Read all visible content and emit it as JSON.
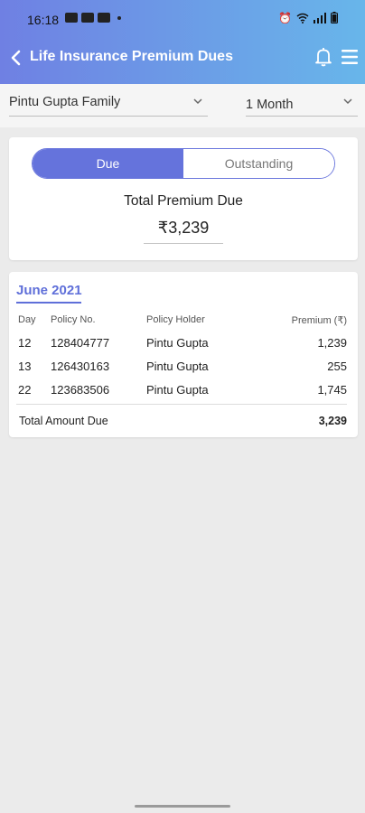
{
  "status_bar": {
    "time": "16:18",
    "left_icons": [
      "image-icon",
      "notification-icon",
      "notification-icon"
    ],
    "right_icons": [
      "alarm-icon",
      "wifi-icon",
      "signal-icon",
      "battery-icon"
    ]
  },
  "header": {
    "title": "Life Insurance Premium Dues",
    "back_icon": "chevron-left-icon",
    "bell_icon": "bell-icon",
    "menu_icon": "hamburger-menu-icon"
  },
  "filters": {
    "family": "Pintu Gupta Family",
    "period": "1 Month"
  },
  "summary": {
    "tabs": [
      "Due",
      "Outstanding"
    ],
    "active_tab": "Due",
    "title": "Total Premium Due",
    "amount": "₹3,239"
  },
  "table": {
    "month": "June 2021",
    "headers": {
      "day": "Day",
      "policy": "Policy No.",
      "holder": "Policy Holder",
      "premium": "Premium (₹)"
    },
    "rows": [
      {
        "day": "12",
        "policy": "128404777",
        "holder": "Pintu Gupta",
        "premium": "1,239"
      },
      {
        "day": "13",
        "policy": "126430163",
        "holder": "Pintu Gupta",
        "premium": "255"
      },
      {
        "day": "22",
        "policy": "123683506",
        "holder": "Pintu Gupta",
        "premium": "1,745"
      }
    ],
    "total_label": "Total Amount Due",
    "total_value": "3,239"
  },
  "colors": {
    "header_gradient_start": "#6f80e3",
    "header_gradient_end": "#68b6ea",
    "accent": "#6573dc",
    "background": "#ebebeb"
  }
}
